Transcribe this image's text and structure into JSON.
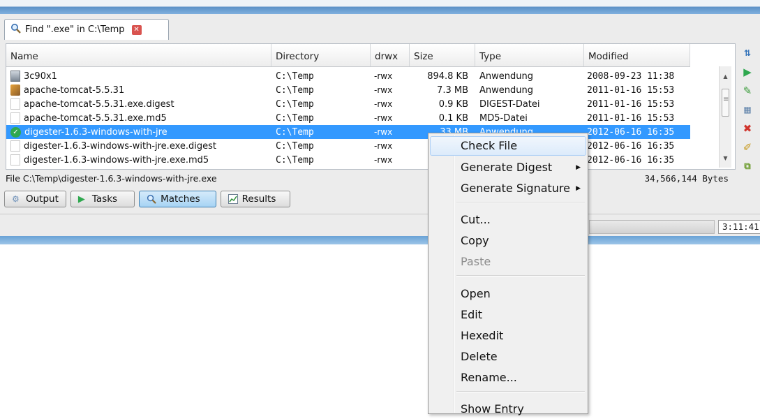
{
  "tab": {
    "title": "Find \".exe\" in C:\\Temp"
  },
  "table": {
    "columns": [
      "Name",
      "Directory",
      "drwx",
      "Size",
      "Type",
      "Modified"
    ],
    "rows": [
      {
        "icon": "app",
        "name": "3c90x1",
        "dir": "C:\\Temp",
        "perm": "-rwx",
        "size": "894.8 KB",
        "type": "Anwendung",
        "modified": "2008-09-23 11:38"
      },
      {
        "icon": "cat",
        "name": "apache-tomcat-5.5.31",
        "dir": "C:\\Temp",
        "perm": "-rwx",
        "size": "7.3 MB",
        "type": "Anwendung",
        "modified": "2011-01-16 15:53"
      },
      {
        "icon": "doc",
        "name": "apache-tomcat-5.5.31.exe.digest",
        "dir": "C:\\Temp",
        "perm": "-rwx",
        "size": "0.9 KB",
        "type": "DIGEST-Datei",
        "modified": "2011-01-16 15:53"
      },
      {
        "icon": "doc",
        "name": "apache-tomcat-5.5.31.exe.md5",
        "dir": "C:\\Temp",
        "perm": "-rwx",
        "size": "0.1 KB",
        "type": "MD5-Datei",
        "modified": "2011-01-16 15:53"
      },
      {
        "icon": "check",
        "name": "digester-1.6.3-windows-with-jre",
        "dir": "C:\\Temp",
        "perm": "-rwx",
        "size": "33 MB",
        "type": "Anwendung",
        "modified": "2012-06-16 16:35",
        "selected": true
      },
      {
        "icon": "doc",
        "name": "digester-1.6.3-windows-with-jre.exe.digest",
        "dir": "C:\\Temp",
        "perm": "-rwx",
        "size": "",
        "type": "",
        "modified": "2012-06-16 16:35"
      },
      {
        "icon": "doc",
        "name": "digester-1.6.3-windows-with-jre.exe.md5",
        "dir": "C:\\Temp",
        "perm": "-rwx",
        "size": "",
        "type": "",
        "modified": "2012-06-16 16:35"
      }
    ]
  },
  "status": {
    "path": "File C:\\Temp\\digester-1.6.3-windows-with-jre.exe",
    "bytes": "34,566,144 Bytes"
  },
  "buttons": {
    "output": "Output",
    "tasks": "Tasks",
    "matches": "Matches",
    "results": "Results"
  },
  "clock": "3:11:41",
  "context_menu": {
    "check_file": "Check File",
    "generate_digest": "Generate Digest",
    "generate_signature": "Generate Signature",
    "cut": "Cut...",
    "copy": "Copy",
    "paste": "Paste",
    "open": "Open",
    "edit": "Edit",
    "hexedit": "Hexedit",
    "delete": "Delete",
    "rename": "Rename...",
    "show_entry": "Show Entry"
  },
  "colors": {
    "selection": "#3399ff",
    "accent": "#5b91c8",
    "menu_bg": "#f0f0f0"
  },
  "icons": {
    "tab": "search-icon",
    "side_tools": [
      "sort-icon",
      "run-icon",
      "edit-pencil-icon",
      "calculator-icon",
      "delete-x-icon",
      "rename-icon",
      "export-icon"
    ]
  }
}
